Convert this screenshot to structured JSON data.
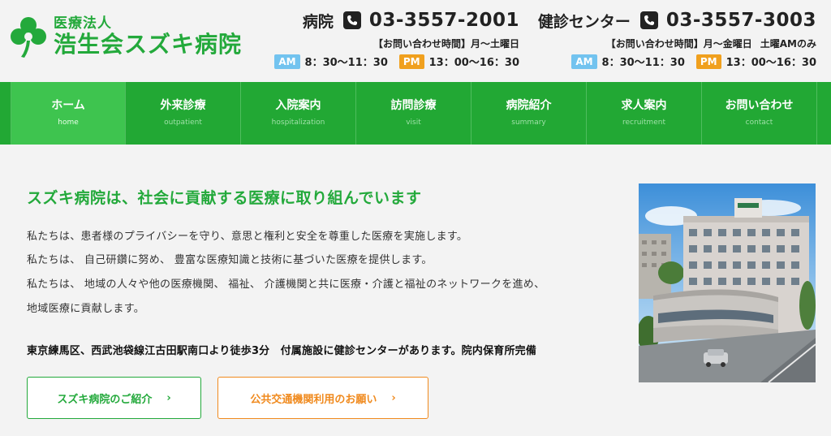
{
  "header": {
    "logo_sub": "医療法人",
    "logo_main": "浩生会スズキ病院",
    "hospital": {
      "label": "病院",
      "number": "03-3557-2001",
      "hours_heading": "【お問い合わせ時間】月〜土曜日",
      "hours_note": "",
      "am_badge": "AM",
      "am_time": "8：30〜11：30",
      "pm_badge": "PM",
      "pm_time": "13：00〜16：30"
    },
    "checkup": {
      "label": "健診センター",
      "number": "03-3557-3003",
      "hours_heading": "【お問い合わせ時間】月〜金曜日",
      "hours_note": "土曜AMのみ",
      "am_badge": "AM",
      "am_time": "8：30〜11：30",
      "pm_badge": "PM",
      "pm_time": "13：00〜16：30"
    }
  },
  "nav": [
    {
      "label": "ホーム",
      "sub": "home"
    },
    {
      "label": "外来診療",
      "sub": "outpatient"
    },
    {
      "label": "入院案内",
      "sub": "hospitalization"
    },
    {
      "label": "訪問診療",
      "sub": "visit"
    },
    {
      "label": "病院紹介",
      "sub": "summary"
    },
    {
      "label": "求人案内",
      "sub": "recruitment"
    },
    {
      "label": "お問い合わせ",
      "sub": "contact"
    }
  ],
  "main": {
    "title": "スズキ病院は、社会に貢献する医療に取り組んでいます",
    "paragraphs": [
      "私たちは、患者様のプライバシーを守り、意思と権利と安全を尊重した医療を実施します。",
      "私たちは、 自己研鑽に努め、 豊富な医療知識と技術に基づいた医療を提供します。",
      "私たちは、 地域の人々や他の医療機関、 福祉、 介護機関と共に医療・介護と福祉のネットワークを進め、",
      "地域医療に貢献します。"
    ],
    "access": "東京練馬区、西武池袋線江古田駅南口より徒歩3分　付属施設に健診センターがあります。院内保育所完備",
    "btn_intro": "スズキ病院のご紹介",
    "btn_transit": "公共交通機関利用のお願い"
  },
  "colors": {
    "brand_green": "#23a93b",
    "nav_green": "#22a834",
    "am_blue": "#72c3ef",
    "pm_orange": "#f0a01e",
    "transit_orange": "#f08a1e"
  },
  "icons": [
    "clover-logo-icon",
    "phone-icon",
    "chevron-right-icon",
    "hospital-building-photo"
  ]
}
